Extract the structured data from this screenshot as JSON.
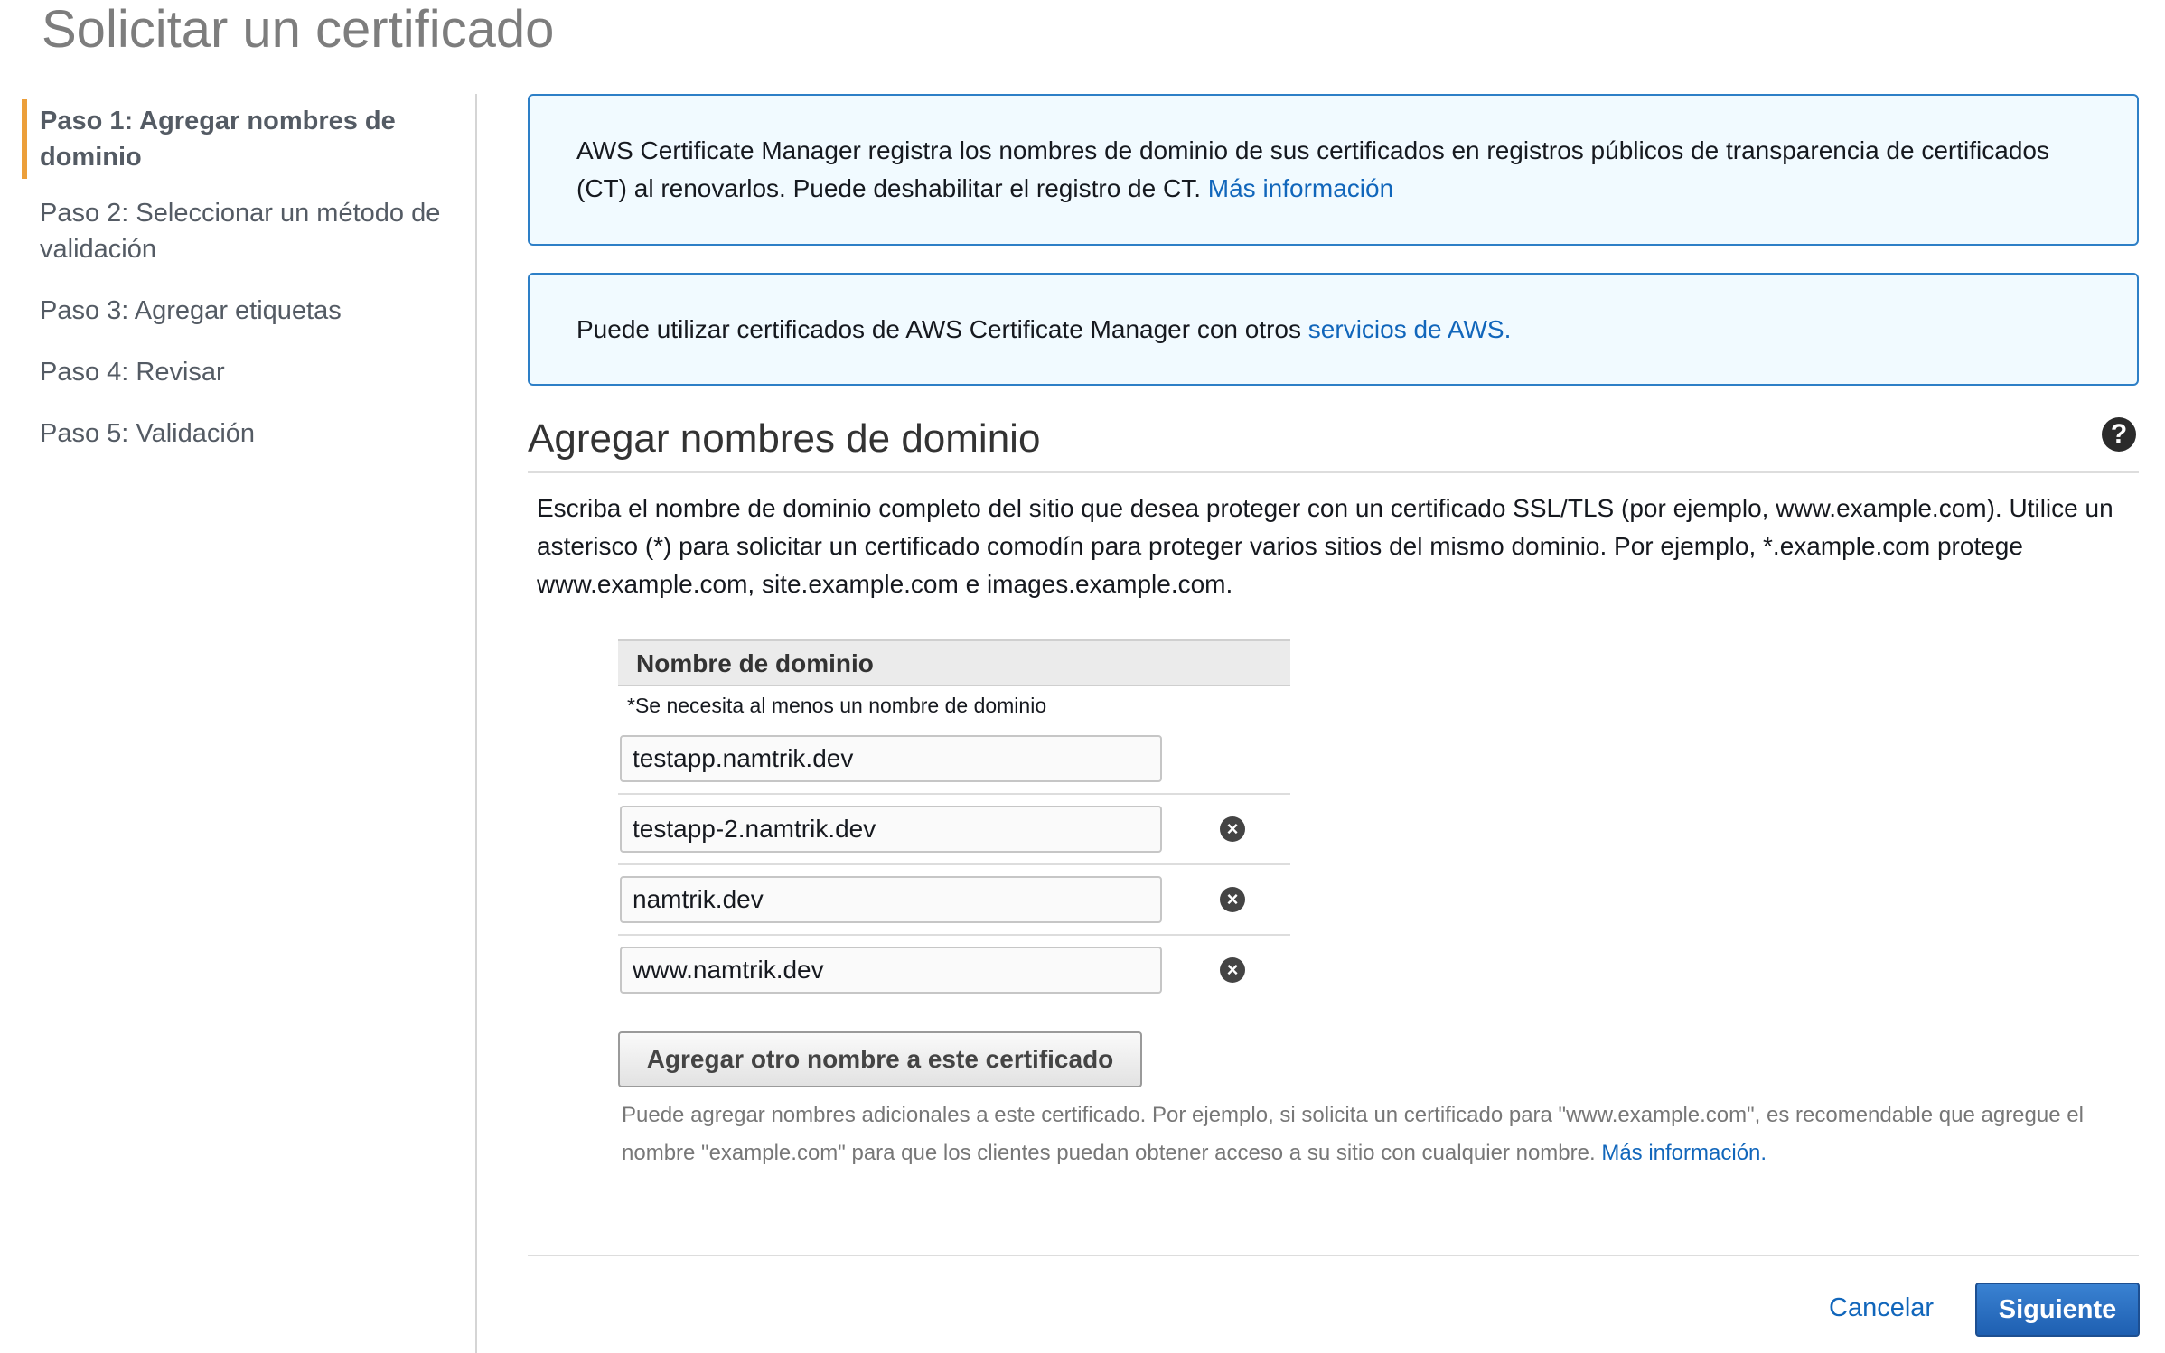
{
  "page": {
    "title": "Solicitar un certificado"
  },
  "steps": [
    {
      "label": "Paso 1: Agregar nombres de dominio",
      "active": true
    },
    {
      "label": "Paso 2: Seleccionar un método de validación",
      "active": false
    },
    {
      "label": "Paso 3: Agregar etiquetas",
      "active": false
    },
    {
      "label": "Paso 4: Revisar",
      "active": false
    },
    {
      "label": "Paso 5: Validación",
      "active": false
    }
  ],
  "info_ct": {
    "text": "AWS Certificate Manager registra los nombres de dominio de sus certificados en registros públicos de transparencia de certificados (CT) al renovarlos. Puede deshabilitar el registro de CT. ",
    "link": "Más información"
  },
  "info_services": {
    "text": "Puede utilizar certificados de AWS Certificate Manager con otros ",
    "link": "servicios de AWS."
  },
  "section": {
    "title": "Agregar nombres de dominio",
    "help_icon": "question-circle-icon",
    "description": "Escriba el nombre de dominio completo del sitio que desea proteger con un certificado SSL/TLS (por ejemplo, www.example.com). Utilice un asterisco (*) para solicitar un certificado comodín para proteger varios sitios del mismo dominio. Por ejemplo, *.example.com protege www.example.com, site.example.com e images.example.com."
  },
  "domain_table": {
    "header": "Nombre de dominio",
    "required_note": "*Se necesita al menos un nombre de dominio",
    "remove_icon": "x-circle-icon",
    "domains": [
      "testapp.namtrik.dev",
      "testapp-2.namtrik.dev",
      "namtrik.dev",
      "www.namtrik.dev"
    ]
  },
  "add_button": {
    "label": "Agregar otro nombre a este certificado"
  },
  "hint": {
    "text": "Puede agregar nombres adicionales a este certificado. Por ejemplo, si solicita un certificado para \"www.example.com\", es recomendable que agregue el nombre \"example.com\" para que los clientes puedan obtener acceso a su sitio con cualquier nombre. ",
    "link": "Más información."
  },
  "footer": {
    "cancel_label": "Cancelar",
    "next_label": "Siguiente"
  },
  "colors": {
    "accent_orange": "#ec9f3a",
    "link_blue": "#1166bb",
    "info_border": "#2d7fc7",
    "info_background": "#f1faff",
    "primary_button": "#1e5fb1"
  }
}
